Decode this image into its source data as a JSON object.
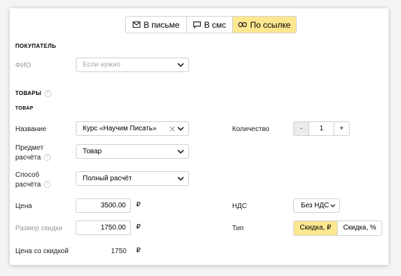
{
  "tabs": [
    {
      "label": "В письме",
      "icon": "mail-icon",
      "active": false
    },
    {
      "label": "В смс",
      "icon": "sms-icon",
      "active": false
    },
    {
      "label": "По ссылке",
      "icon": "link-icon",
      "active": true
    }
  ],
  "buyer": {
    "section_title": "ПОКУПАТЕЛЬ",
    "name_label": "ФИО",
    "name_value": "Если нужно"
  },
  "goods": {
    "section_title": "ТОВАРЫ",
    "item_title": "ТОВАР",
    "title_label": "Название",
    "title_value": "Курс «Научим Писать»",
    "subject_label_1": "Предмет",
    "subject_label_2": "расчёта",
    "subject_value": "Товар",
    "method_label_1": "Способ",
    "method_label_2": "расчёта",
    "method_value": "Полный расчёт",
    "price_label": "Цена",
    "price_value": "3500.00",
    "discount_label": "Размер скидки",
    "discount_value": "1750.00",
    "discounted_label": "Цена со скидкой",
    "discounted_value": "1750",
    "currency": "₽",
    "quantity_label": "Количество",
    "quantity_minus": "-",
    "quantity_value": "1",
    "quantity_plus": "+",
    "vat_label": "НДС",
    "vat_value": "Без НДС",
    "type_label": "Тип",
    "type_options": [
      {
        "label": "Скидка, ₽",
        "active": true
      },
      {
        "label": "Скидка, %",
        "active": false
      }
    ]
  },
  "colors": {
    "accent": "#fde78f",
    "border": "#d0d0d0",
    "muted": "#9a9a9a"
  }
}
